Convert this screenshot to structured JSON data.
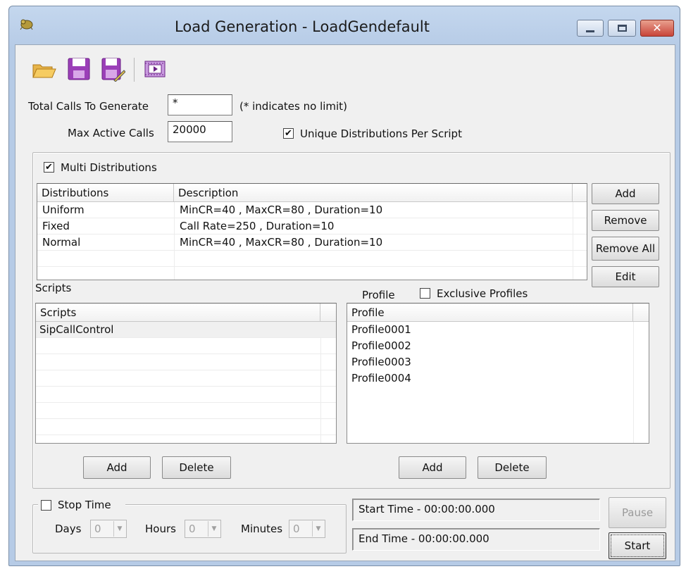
{
  "window": {
    "title": "Load Generation - LoadGendefault"
  },
  "toolbar": {
    "icons": [
      "open-folder-icon",
      "save-icon",
      "save-as-icon",
      "play-video-icon"
    ]
  },
  "settings": {
    "total_calls_label": "Total Calls To Generate",
    "total_calls_value": "*",
    "total_calls_hint": "(* indicates no limit)",
    "max_active_label": "Max Active Calls",
    "max_active_value": "20000",
    "unique_dist_label": "Unique Distributions Per Script",
    "unique_dist_checked": true
  },
  "distributions": {
    "multi_label": "Multi Distributions",
    "multi_checked": true,
    "columns": [
      "Distributions",
      "Description"
    ],
    "rows": [
      {
        "name": "Uniform",
        "description": "MinCR=40 , MaxCR=80 , Duration=10"
      },
      {
        "name": "Fixed",
        "description": "Call Rate=250 , Duration=10"
      },
      {
        "name": "Normal",
        "description": "MinCR=40 , MaxCR=80 , Duration=10"
      }
    ],
    "buttons": {
      "add": "Add",
      "remove": "Remove",
      "remove_all": "Remove All",
      "edit": "Edit"
    }
  },
  "scripts": {
    "section_label": "Scripts",
    "column": "Scripts",
    "rows": [
      "SipCallControl"
    ],
    "add_label": "Add",
    "delete_label": "Delete"
  },
  "profiles": {
    "section_label": "Profile",
    "exclusive_label": "Exclusive Profiles",
    "exclusive_checked": false,
    "column": "Profile",
    "rows": [
      "Profile0001",
      "Profile0002",
      "Profile0003",
      "Profile0004"
    ],
    "add_label": "Add",
    "delete_label": "Delete"
  },
  "stop_time": {
    "label": "Stop Time",
    "checked": false,
    "days_label": "Days",
    "days_value": "0",
    "hours_label": "Hours",
    "hours_value": "0",
    "minutes_label": "Minutes",
    "minutes_value": "0"
  },
  "status": {
    "start_time": "Start Time - 00:00:00.000",
    "end_time": "End Time  - 00:00:00.000",
    "pause_label": "Pause",
    "start_label": "Start"
  }
}
